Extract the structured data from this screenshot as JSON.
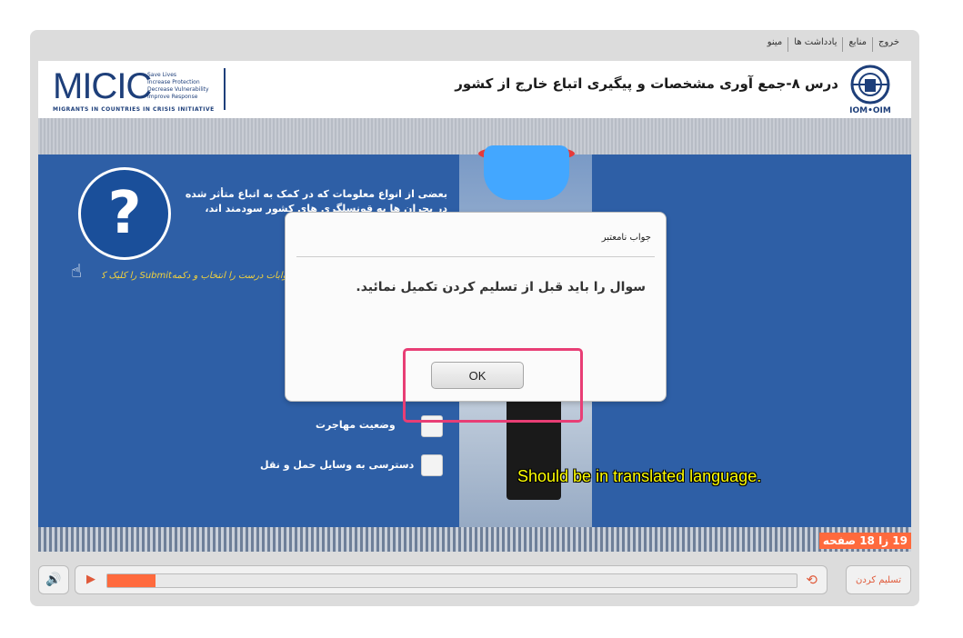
{
  "topmenu": [
    "خروج",
    "منابع",
    "یادداشت ها",
    "مینو"
  ],
  "header": {
    "title": "درس ۸-جمع آوری مشخصات و پیگیری اتباع خارج از کشور",
    "micic": {
      "wordmark": "MICIC",
      "tags": [
        "Save Lives",
        "Increase Protection",
        "Decrease Vulnerability",
        "Improve Response"
      ],
      "subtitle": "MIGRANTS IN COUNTRIES IN CRISIS INITIATIVE"
    },
    "iom_label": "IOM•OIM"
  },
  "question": {
    "text": "بعضی از انواع معلومات که در کمک به اتباع متأثر شده در بحران ها به قونسلگری های کشور سودمند اند، کدام"
  },
  "instruction": "جوابات درست را انتخاب و دکمهSubmit را کلیک کنید.",
  "options": [
    {
      "label": "وضعیت مهاجرت"
    },
    {
      "label": "دسترسی به وسایل حمل و نقل"
    }
  ],
  "caption": "Should be in translated language.",
  "timer": "19 زا 18 صفحه",
  "controls": {
    "submit_label": "تسلیم کردن",
    "progress": 0.07
  },
  "dialog": {
    "title": "جواب نامعتبر",
    "message": "سوال را باید قبل از تسلیم کردن تکمیل نمائید.",
    "ok_label": "OK"
  },
  "colors": {
    "slide_blue": "#2e5fa6",
    "accent": "#ff6a3d",
    "highlight": "#e83e75",
    "caption": "#ffff00"
  }
}
